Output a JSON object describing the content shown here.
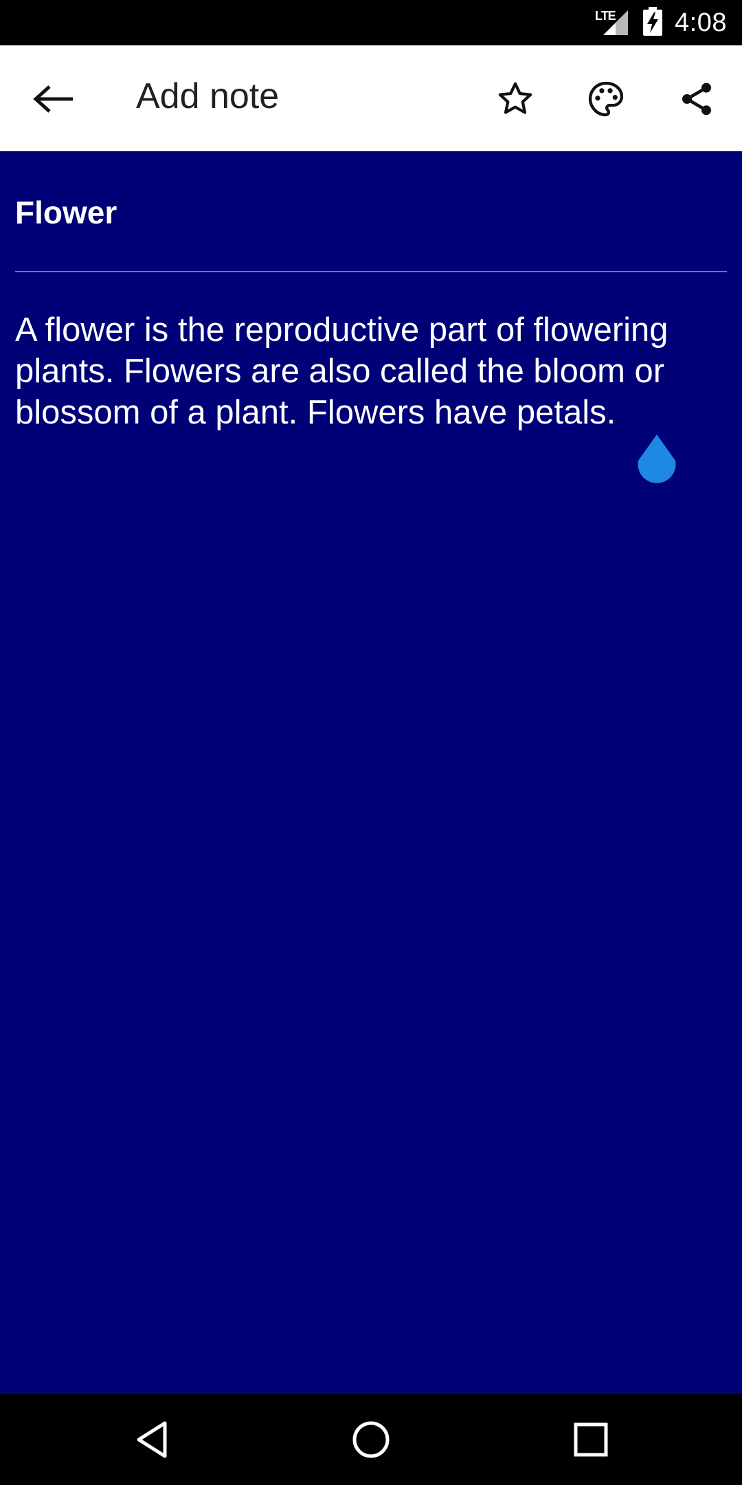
{
  "status_bar": {
    "network": "LTE",
    "time": "4:08",
    "icons": [
      "lte-signal-icon",
      "battery-charging-icon"
    ]
  },
  "app_bar": {
    "back_icon": "arrow-left-icon",
    "title": "Add note",
    "actions": [
      {
        "icon": "star-outline-icon",
        "label": "Favorite"
      },
      {
        "icon": "palette-icon",
        "label": "Color"
      },
      {
        "icon": "share-icon",
        "label": "Share"
      }
    ]
  },
  "note": {
    "title": "Flower",
    "body_lines": [
      "A flower is the reproductive part of flowering",
      "plants. Flowers are also called the bloom or",
      "blossom of a plant. Flowers have petals."
    ],
    "background_color": "#000077",
    "text_color": "#ffffff"
  },
  "cursor_handle_color": "#1e88e5",
  "nav_bar": {
    "buttons": [
      "back-triangle-icon",
      "home-circle-icon",
      "recents-square-icon"
    ]
  }
}
